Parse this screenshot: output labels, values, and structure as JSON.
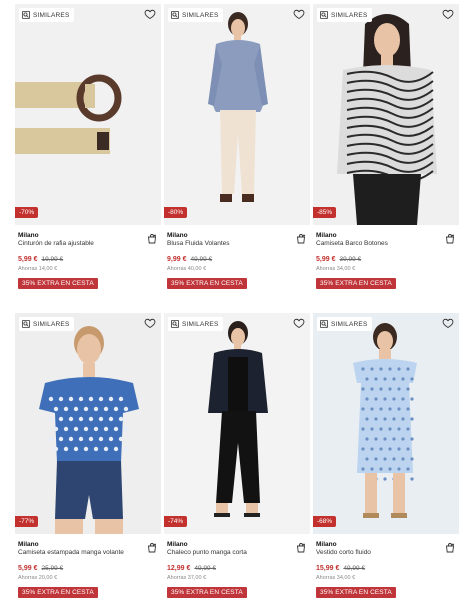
{
  "similar_label": "SIMILARES",
  "extra_label": "35% EXTRA EN CESTA",
  "products": [
    {
      "brand": "Milano",
      "name": "Cinturón de rafia ajustable",
      "price": "5,99 €",
      "old_price": "19,99 €",
      "alt_price": "Ahorras 14,00 €",
      "discount": "-70%",
      "figure": "belt"
    },
    {
      "brand": "Milano",
      "name": "Blusa Fluida Volantes",
      "price": "9,99 €",
      "old_price": "49,99 €",
      "alt_price": "Ahorras 40,00 €",
      "discount": "-80%",
      "figure": "blouse"
    },
    {
      "brand": "Milano",
      "name": "Camiseta Barco Botones",
      "price": "5,99 €",
      "old_price": "39,99 €",
      "alt_price": "Ahorras 34,00 €",
      "discount": "-85%",
      "figure": "zebra"
    },
    {
      "brand": "Milano",
      "name": "Camiseta estampada manga volante",
      "price": "5,99 €",
      "old_price": "25,99 €",
      "alt_price": "Ahorras 20,00 €",
      "discount": "-77%",
      "figure": "tee"
    },
    {
      "brand": "Milano",
      "name": "Chaleco punto manga corta",
      "price": "12,99 €",
      "old_price": "49,99 €",
      "alt_price": "Ahorras 37,00 €",
      "discount": "-74%",
      "figure": "vest"
    },
    {
      "brand": "Milano",
      "name": "Vestido corto fluido",
      "price": "15,99 €",
      "old_price": "49,99 €",
      "alt_price": "Ahorras 34,00 €",
      "discount": "-68%",
      "figure": "dress"
    }
  ],
  "colors": {
    "accent": "#c2312e",
    "image_bg": "#f1f1f1"
  }
}
